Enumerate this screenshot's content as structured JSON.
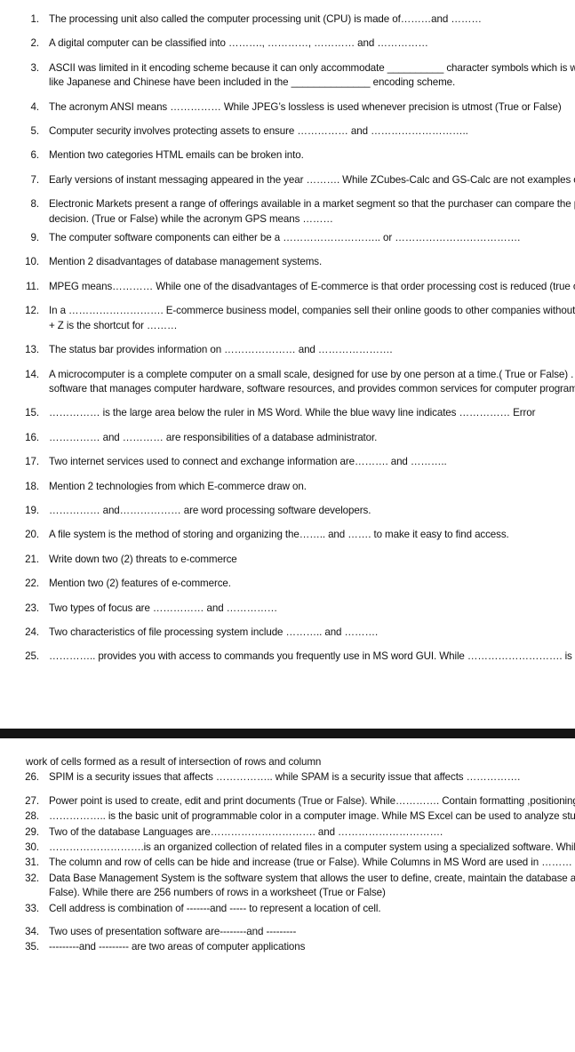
{
  "document": {
    "type": "exam-question-sheet",
    "background_color": "#ffffff",
    "text_color": "#111111",
    "divider_color": "#151515"
  },
  "section_a": {
    "items": [
      {
        "number": "1.",
        "text": "The processing unit also called the computer processing unit (CPU) is made of………and ………"
      },
      {
        "number": "2.",
        "text": "A digital computer can  be classified into ………., …………, ………… and ……………"
      },
      {
        "number": "3.",
        "text": "ASCII was limited in it encoding scheme because it can only accommodate  __________ character symbols which is why there are other encoding schemes, languages like Japanese and Chinese have been included in the ______________ encoding scheme."
      },
      {
        "number": "4.",
        "text": "The acronym ANSI means …………… While JPEG’s lossless is used whenever precision is utmost (True or False)"
      },
      {
        "number": "5.",
        "text": "Computer security involves protecting assets to ensure …………… and ……………………….."
      },
      {
        "number": "6.",
        "text": "Mention two categories HTML emails can be broken into."
      },
      {
        "number": "7.",
        "text": "Early versions of instant messaging appeared in the year ………. While  ZCubes-Calc  and GS-Calc are  not examples of spreadsheet software (true or False)"
      },
      {
        "number": "8.",
        "text": "Electronic Markets present a range of offerings available in a market segment so that the purchaser can compare the prices of the offerings and make a purchase decision. (True or False) while the acronym GPS means ………"
      },
      {
        "number": "9.",
        "text": "The computer software components can either be a ……………………….. or ………………………………."
      },
      {
        "number": "10.",
        "text": "Mention 2 disadvantages of database management systems."
      },
      {
        "number": "11.",
        "text": "MPEG means………… While one of the disadvantages of E-commerce is that order processing cost is reduced (true or False)"
      },
      {
        "number": "12.",
        "text": "In a ………………………. E-commerce business model, companies sell their online goods to other companies without being engaged in sales to consumers. While Ctrl + Z is the shortcut for ………"
      },
      {
        "number": "13.",
        "text": "The status bar provides information on ………………… and …………………."
      },
      {
        "number": "14.",
        "text": "A microcomputer is a complete computer on a small scale, designed for use by one person at a time.( True or False) . While An operating system or OS is system software that manages computer hardware, software resources, and provides common services for computer programs. (True or False)"
      },
      {
        "number": "15.",
        "text": "…………… is the large area below the ruler in MS Word. While the blue wavy line indicates …………… Error"
      },
      {
        "number": "16.",
        "text": "…………… and ………… are responsibilities of a database administrator."
      },
      {
        "number": "17.",
        "text": "Two internet services used to connect and exchange information are………. and ……….."
      },
      {
        "number": "18.",
        "text": "Mention 2 technologies from which E-commerce draw on."
      },
      {
        "number": "19.",
        "text": "…………… and……………… are word processing software developers."
      },
      {
        "number": "20.",
        "text": "A file system is the method of storing and organizing the…….. and ……. to make it easy to find access."
      },
      {
        "number": "21.",
        "text": "Write down two (2)  threats to e-commerce"
      },
      {
        "number": "22.",
        "text": "Mention two (2) features of e-commerce."
      },
      {
        "number": "23.",
        "text": "Two types of focus are …………… and ……………"
      },
      {
        "number": "24.",
        "text": "Two characteristics of file processing system include ……….. and ………."
      },
      {
        "number": "25.",
        "text": "…………..  provides you with access to commands you frequently use in MS word GUI. While ………………………. is a network"
      }
    ]
  },
  "section_b": {
    "orphan_line": "work of cells formed as a result of intersection of rows and column",
    "items": [
      {
        "number": "26.",
        "text": "SPIM is a security issues that affects …………….. while SPAM is a  security issue that affects ……………."
      },
      {
        "number": "27.",
        "text": "Power point is used to create, edit and print documents (True or False). While…………. Contain formatting ,positioning and placeholders for all of the contents in a slide"
      },
      {
        "number": "28.",
        "text": "…………….. is the basic unit of programmable color in a computer image. While MS Excel can be used to analyze student result (True or False)"
      },
      {
        "number": "29.",
        "text": "Two of the database Languages are…………………………. and …………………………."
      },
      {
        "number": "30.",
        "text": "……………………….is an organized collection of related files in a computer system  using a specialized  software. While EBCDIC means –--"
      },
      {
        "number": "31.",
        "text": "The column and row of cells can be hide and increase (true or False). While Columns in MS Word are used in ………"
      },
      {
        "number": "32.",
        "text": "Data Base Management System is the software system that allows the user to define, create, maintain the database and provide control access to the data (True or False).  While there are 256 numbers of rows in a worksheet (True or False)"
      },
      {
        "number": "33.",
        "text": "Cell address is combination of -------and ----- to represent a location of cell."
      },
      {
        "number": "34.",
        "text": "Two uses of presentation software are--------and ---------"
      },
      {
        "number": "35.",
        "text": "---------and --------- are two areas of computer applications"
      }
    ]
  }
}
